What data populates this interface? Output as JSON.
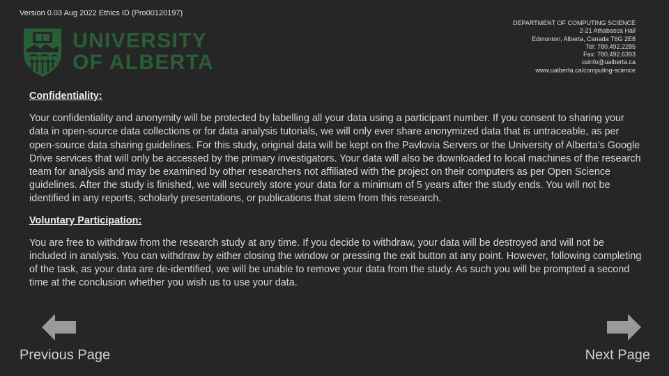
{
  "header": {
    "version_text": "Version 0.03 Aug 2022 Ethics ID (Pro00120197)",
    "logo_line1": "UNIVERSITY",
    "logo_line2": "OF ALBERTA",
    "department": [
      "DEPARTMENT OF COMPUTING SCIENCE",
      "2-21 Athabasca Hall",
      "Edmonton, Alberta, Canada T6G 2E8",
      "Tel: 780.492.2285",
      "Fax: 780.492.6393",
      "csinfo@ualberta.ca",
      "www.ualberta.ca/computing-science"
    ]
  },
  "sections": [
    {
      "heading": "Confidentiality:",
      "body": "Your confidentiality and anonymity will be protected by labelling all your data using a participant number. If you consent to sharing your data in open-source data collections or for data analysis tutorials, we will only ever share anonymized data that is untraceable, as per open-source data sharing guidelines. For this study, original data will be kept on the Pavlovia Servers or the University of Alberta’s Google Drive services that will only be accessed by the primary investigators. Your data will also be downloaded to local machines of the research team for analysis and may be examined by other researchers not affiliated with the project on their computers as per Open Science guidelines. After the study is finished, we will securely store your data for a minimum of 5 years after the study ends. You will not be identified in any reports, scholarly presentations, or publications that stem from this research."
    },
    {
      "heading": "Voluntary Participation:",
      "body": "You are free to withdraw from the research study at any time. If you decide to withdraw, your data will be destroyed and will not be included in analysis. You can withdraw by either closing the window or pressing the exit button at any point. However, following completing of the task, as your data are de-identified, we will be unable to remove your data from the study. As such you will be prompted a second time at the conclusion whether you wish us to use your data."
    }
  ],
  "nav": {
    "prev_label": "Previous Page",
    "next_label": "Next Page",
    "prev_icon": "arrow-left-icon",
    "next_icon": "arrow-right-icon"
  },
  "colors": {
    "background": "#262626",
    "brand_green": "#295f38",
    "arrow_gray": "#9a9a9a",
    "text": "#d8d8d8"
  }
}
